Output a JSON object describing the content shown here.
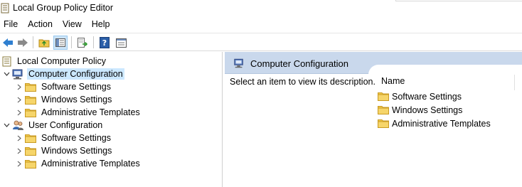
{
  "window": {
    "title": "Local Group Policy Editor"
  },
  "menu": [
    "File",
    "Action",
    "View",
    "Help"
  ],
  "toolbar": {
    "buttons": [
      "back-arrow-icon",
      "forward-arrow-icon",
      "up-folder-icon",
      "show-hide-tree-icon",
      "export-list-icon",
      "help-icon",
      "properties-icon"
    ]
  },
  "tree": {
    "root": "Local Computer Policy",
    "computer": {
      "label": "Computer Configuration",
      "children": [
        "Software Settings",
        "Windows Settings",
        "Administrative Templates"
      ]
    },
    "user": {
      "label": "User Configuration",
      "children": [
        "Software Settings",
        "Windows Settings",
        "Administrative Templates"
      ]
    }
  },
  "details": {
    "title": "Computer Configuration",
    "description": "Select an item to view its description.",
    "column_name": "Name",
    "items": [
      "Software Settings",
      "Windows Settings",
      "Administrative Templates"
    ]
  },
  "colors": {
    "selection": "#cce8ff",
    "header_band": "#c9d8ec",
    "folder": "#f0c84a"
  }
}
